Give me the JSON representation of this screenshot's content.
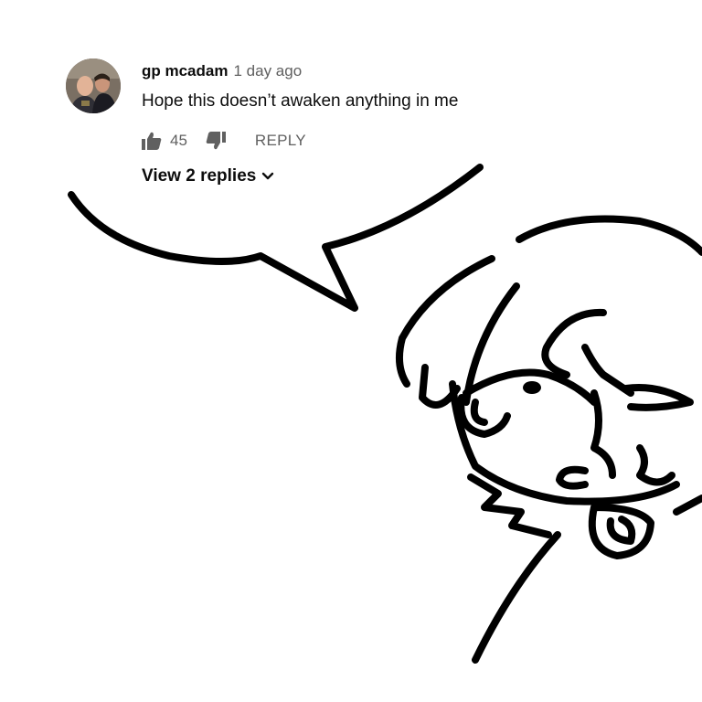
{
  "comment": {
    "author": "gp mcadam",
    "time": "1 day ago",
    "text": "Hope this doesn’t awaken anything in me",
    "likes": "45",
    "reply_label": "REPLY",
    "view_replies_label": "View 2 replies"
  },
  "icons": {
    "like": "thumbs-up-icon",
    "dislike": "thumbs-down-icon",
    "expand": "chevron-down-icon"
  },
  "colors": {
    "text_primary": "#0d0d0d",
    "text_secondary": "#606060",
    "drawing_stroke": "#000000"
  }
}
